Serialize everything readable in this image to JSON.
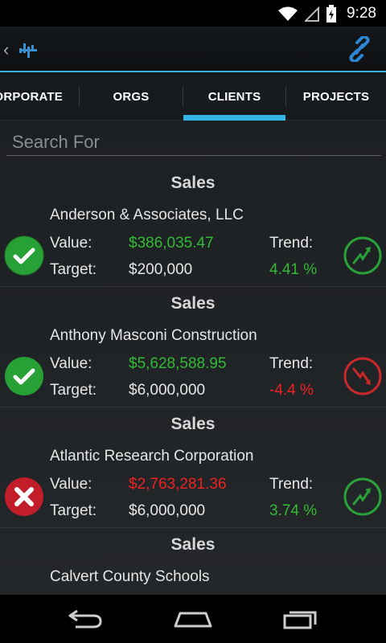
{
  "status_bar": {
    "time": "9:28"
  },
  "tabs": [
    {
      "label": "ORPORATE",
      "selected": false
    },
    {
      "label": "ORGS",
      "selected": false
    },
    {
      "label": "CLIENTS",
      "selected": true
    },
    {
      "label": "PROJECTS",
      "selected": false
    }
  ],
  "search": {
    "placeholder": "Search For",
    "value": ""
  },
  "cards": [
    {
      "section": "Sales",
      "name": "Anderson & Associates, LLC",
      "value_label": "Value:",
      "value": "$386,035.47",
      "target_label": "Target:",
      "target": "$200,000",
      "trend_label": "Trend:",
      "trend": "4.41 %",
      "status": "ok",
      "trend_dir": "up"
    },
    {
      "section": "Sales",
      "name": "Anthony Masconi Construction",
      "value_label": "Value:",
      "value": "$5,628,588.95",
      "target_label": "Target:",
      "target": "$6,000,000",
      "trend_label": "Trend:",
      "trend": "-4.4 %",
      "status": "ok",
      "trend_dir": "down"
    },
    {
      "section": "Sales",
      "name": "Atlantic Research Corporation",
      "value_label": "Value:",
      "value": "$2,763,281.36",
      "target_label": "Target:",
      "target": "$6,000,000",
      "trend_label": "Trend:",
      "trend": "3.74 %",
      "status": "fail",
      "trend_dir": "up"
    },
    {
      "section": "Sales",
      "name": "Calvert County Schools"
    }
  ],
  "colors": {
    "accent": "#33b5e5",
    "positive": "#33bb33",
    "negative": "#ee2222"
  },
  "icons": {
    "status_ok": "check-circle-icon",
    "status_fail": "x-circle-icon",
    "trend_up": "trend-up-icon",
    "trend_down": "trend-down-icon",
    "link": "link-icon",
    "app_logo": "app-logo-icon"
  }
}
